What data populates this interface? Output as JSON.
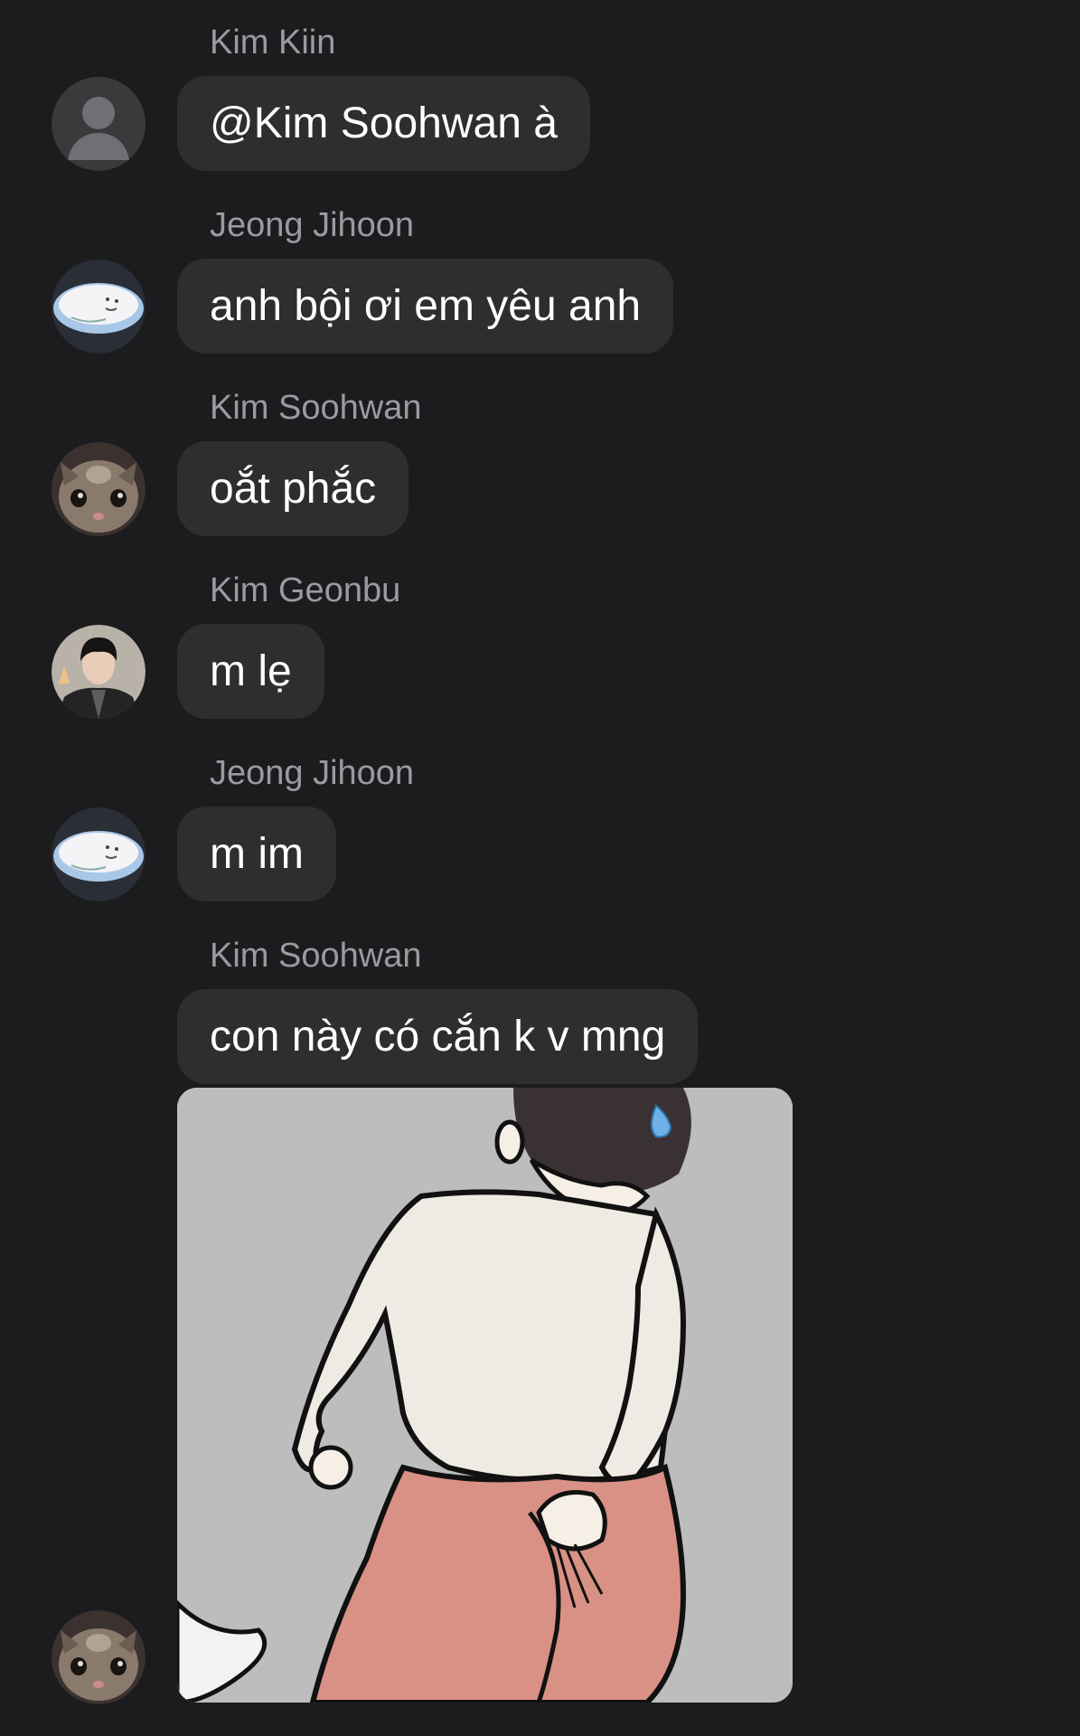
{
  "messages": [
    {
      "sender": "Kim Kiin",
      "text": "@Kim Soohwan à",
      "avatar": "default-person-icon"
    },
    {
      "sender": "Jeong Jihoon",
      "text": "anh bội ơi em yêu anh",
      "avatar": "cloud-avatar"
    },
    {
      "sender": "Kim Soohwan",
      "text": "oắt phắc",
      "avatar": "cat-avatar"
    },
    {
      "sender": "Kim Geonbu",
      "text": "m lẹ",
      "avatar": "person-photo-avatar"
    },
    {
      "sender": "Jeong Jihoon",
      "text": "m im",
      "avatar": "cloud-avatar"
    },
    {
      "sender": "Kim Soohwan",
      "text": "con này có cắn k v mng",
      "avatar": "cat-avatar"
    }
  ],
  "image_message": {
    "description_icon": "cartoon-sticker-image"
  },
  "colors": {
    "background": "#1c1c1e",
    "bubble": "#2e2e31",
    "sender_name": "#9a9aa0",
    "text": "#ffffff"
  }
}
